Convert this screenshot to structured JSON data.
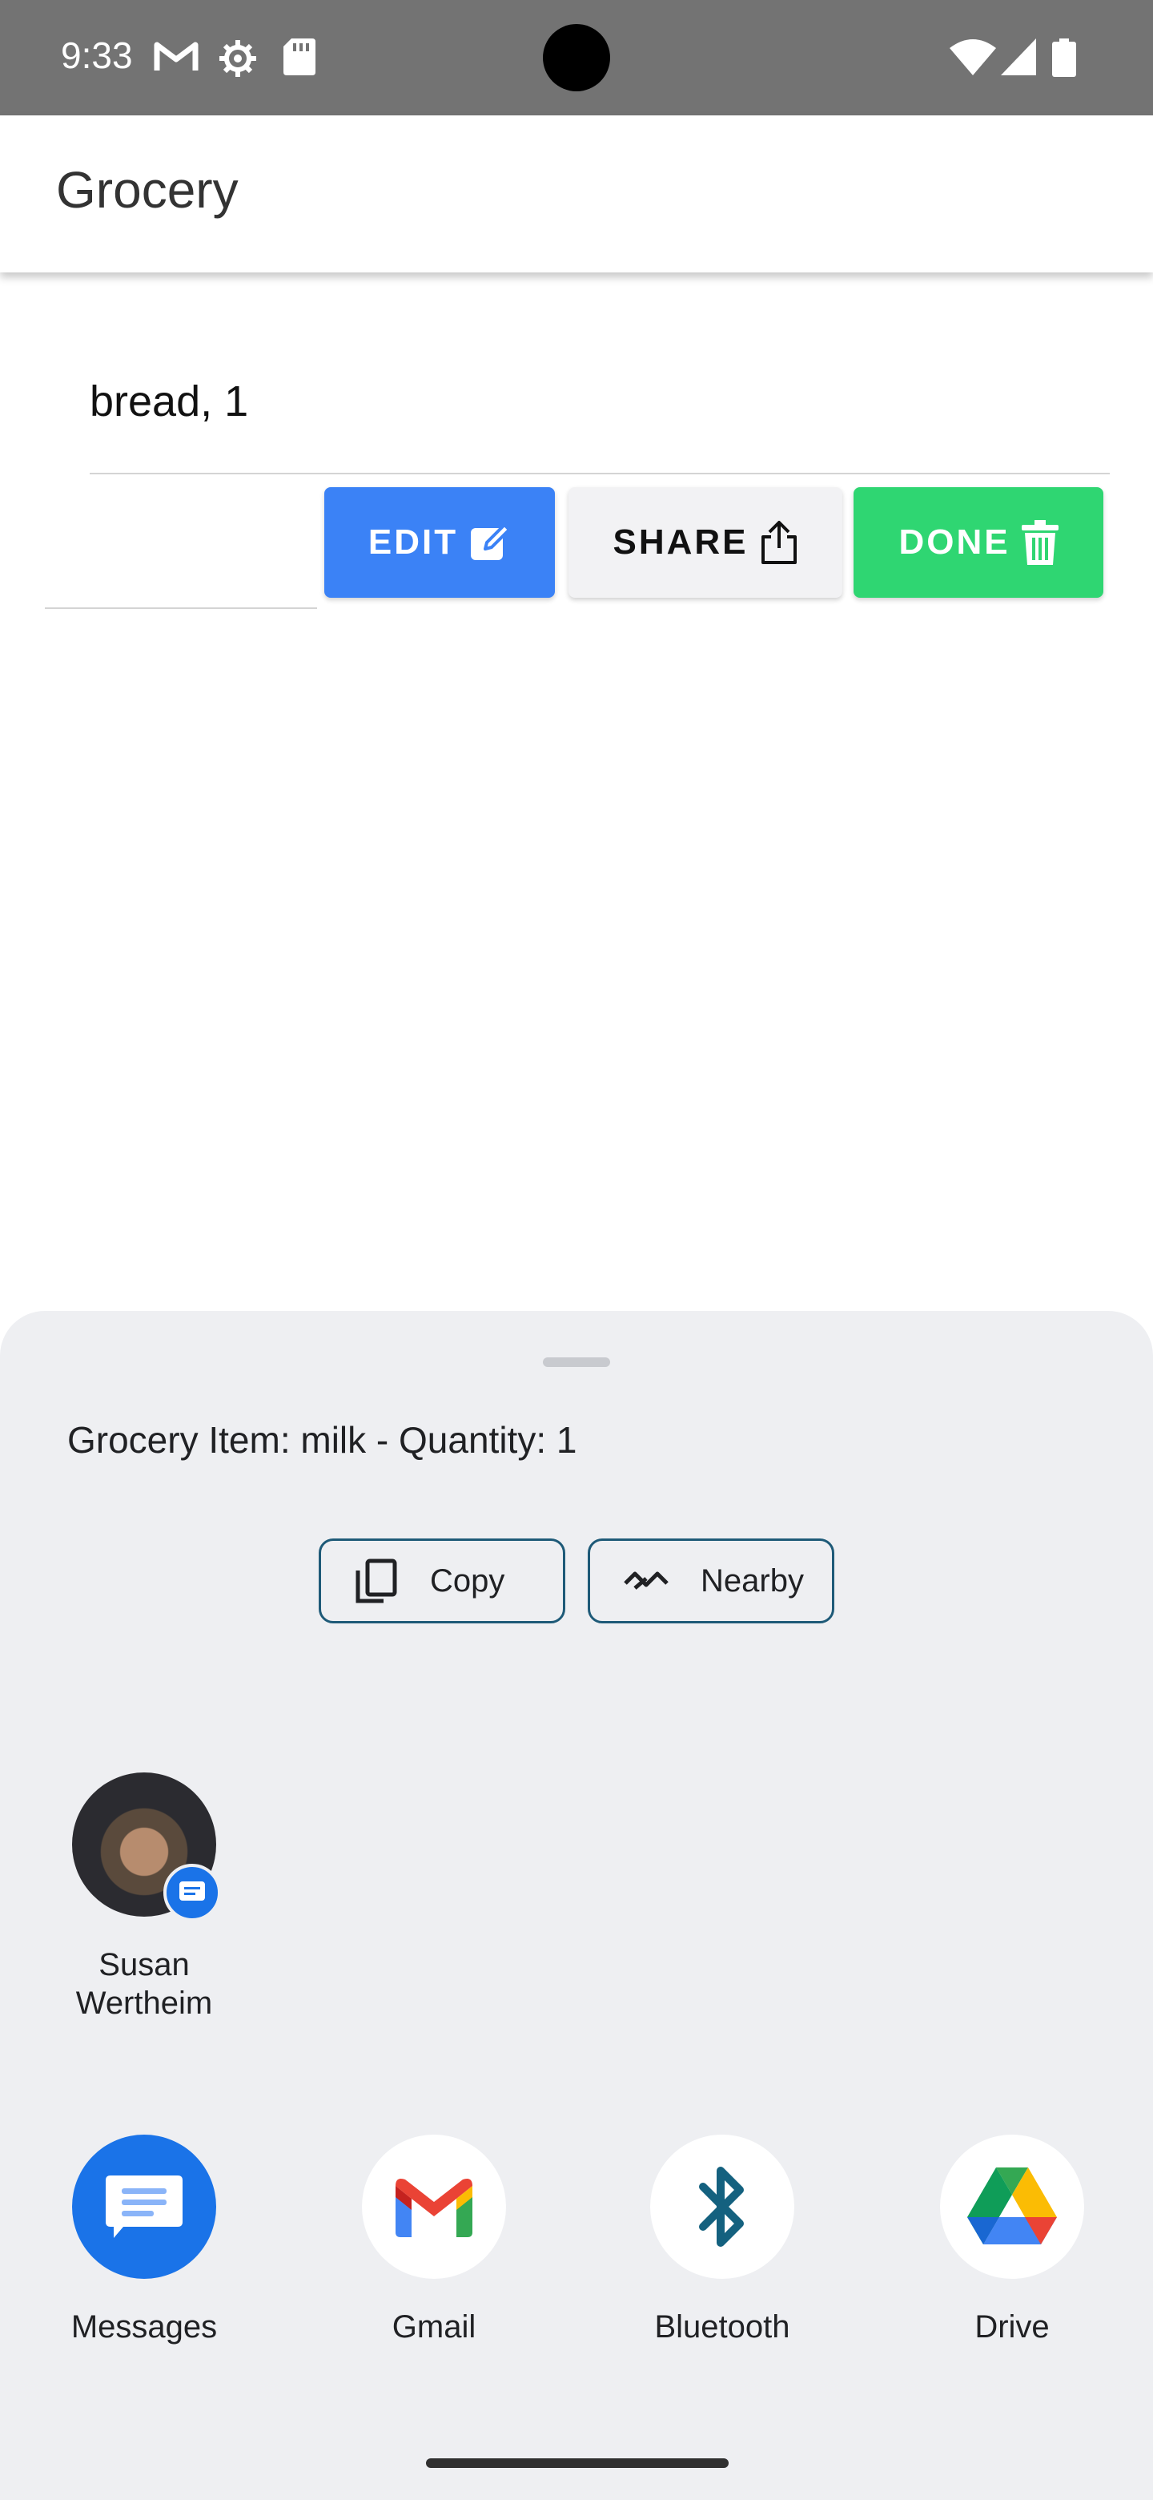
{
  "status_bar": {
    "time": "9:33",
    "icons": [
      "gmail-icon",
      "settings-icon",
      "sd-card-icon",
      "wifi-icon",
      "signal-icon",
      "battery-icon"
    ]
  },
  "app_bar": {
    "title": "Grocery"
  },
  "list": {
    "item_text": "bread, 1",
    "actions": {
      "edit_label": "EDIT",
      "share_label": "SHARE",
      "done_label": "DONE"
    }
  },
  "share_sheet": {
    "preview_text": "Grocery Item: milk - Quantity: 1",
    "chips": {
      "copy_label": "Copy",
      "nearby_label": "Nearby"
    },
    "contact": {
      "name_line1": "Susan",
      "name_line2": "Wertheim"
    },
    "apps": {
      "messages_label": "Messages",
      "gmail_label": "Gmail",
      "bluetooth_label": "Bluetooth",
      "drive_label": "Drive"
    }
  },
  "colors": {
    "edit": "#3b82f6",
    "share": "#f2f2f4",
    "done": "#2fd672",
    "sheet_bg": "#eeeff2",
    "chip_border": "#1e5a78"
  }
}
